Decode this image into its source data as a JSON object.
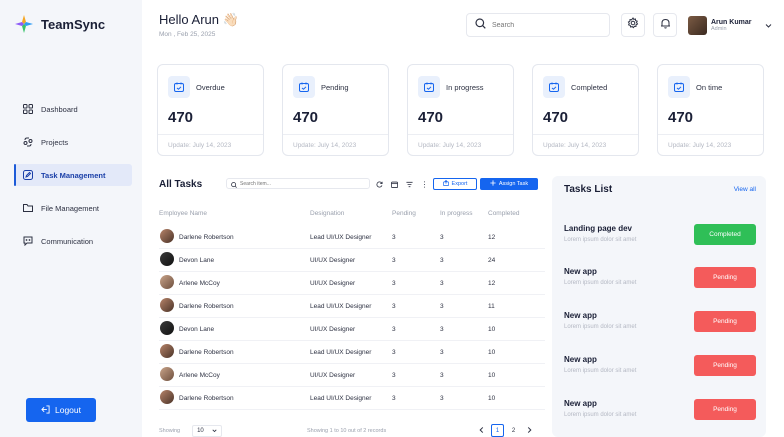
{
  "app": {
    "name": "TeamSync"
  },
  "sidebar": {
    "items": [
      {
        "label": "Dashboard",
        "icon": "grid-icon"
      },
      {
        "label": "Projects",
        "icon": "projects-icon"
      },
      {
        "label": "Task Management",
        "icon": "task-edit-icon",
        "active": true
      },
      {
        "label": "File Management",
        "icon": "folder-icon"
      },
      {
        "label": "Communication",
        "icon": "chat-icon"
      }
    ],
    "logout_label": "Logout"
  },
  "header": {
    "greeting": "Hello Arun 👋🏻",
    "date": "Mon , Feb 25, 2025",
    "search_placeholder": "Search",
    "user_name": "Arun Kumar",
    "user_role": "Admin"
  },
  "stats": [
    {
      "label": "Overdue",
      "value": "470",
      "update": "Update: July 14, 2023"
    },
    {
      "label": "Pending",
      "value": "470",
      "update": "Update: July 14, 2023"
    },
    {
      "label": "In progress",
      "value": "470",
      "update": "Update: July 14, 2023"
    },
    {
      "label": "Completed",
      "value": "470",
      "update": "Update: July 14, 2023"
    },
    {
      "label": "On time",
      "value": "470",
      "update": "Update: July 14, 2023"
    }
  ],
  "all_tasks": {
    "title": "All Tasks",
    "search_placeholder": "Search item...",
    "export_label": "Export",
    "assign_label": "Assign Task",
    "columns": [
      "Employee Name",
      "Designation",
      "Pending",
      "In progress",
      "Completed"
    ],
    "rows": [
      {
        "name": "Darlene Robertson",
        "designation": "Lead UI/UX Designer",
        "pending": "3",
        "progress": "3",
        "completed": "12"
      },
      {
        "name": "Devon Lane",
        "designation": "UI/UX Designer",
        "pending": "3",
        "progress": "3",
        "completed": "24"
      },
      {
        "name": "Arlene McCoy",
        "designation": "UI/UX Designer",
        "pending": "3",
        "progress": "3",
        "completed": "12"
      },
      {
        "name": "Darlene Robertson",
        "designation": "Lead UI/UX Designer",
        "pending": "3",
        "progress": "3",
        "completed": "11"
      },
      {
        "name": "Devon Lane",
        "designation": "UI/UX Designer",
        "pending": "3",
        "progress": "3",
        "completed": "10"
      },
      {
        "name": "Darlene Robertson",
        "designation": "Lead UI/UX Designer",
        "pending": "3",
        "progress": "3",
        "completed": "10"
      },
      {
        "name": "Arlene McCoy",
        "designation": "UI/UX Designer",
        "pending": "3",
        "progress": "3",
        "completed": "10"
      },
      {
        "name": "Darlene Robertson",
        "designation": "Lead UI/UX Designer",
        "pending": "3",
        "progress": "3",
        "completed": "10"
      }
    ],
    "footer": {
      "showing_label": "Showing",
      "page_size": "10",
      "info": "Showing 1 to 10 out of 2 records",
      "pages": [
        "1",
        "2"
      ]
    }
  },
  "tasks_list": {
    "title": "Tasks List",
    "view_all": "View all",
    "items": [
      {
        "name": "Landing page dev",
        "desc": "Lorem ipsum dolor sit amet",
        "status": "Completed",
        "color": "#2fbf57"
      },
      {
        "name": "New app",
        "desc": "Lorem ipsum dolor sit amet",
        "status": "Pending",
        "color": "#f45b5b"
      },
      {
        "name": "New app",
        "desc": "Lorem ipsum dolor sit amet",
        "status": "Pending",
        "color": "#f45b5b"
      },
      {
        "name": "New app",
        "desc": "Lorem ipsum dolor sit amet",
        "status": "Pending",
        "color": "#f45b5b"
      },
      {
        "name": "New app",
        "desc": "Lorem ipsum dolor sit amet",
        "status": "Pending",
        "color": "#f45b5b"
      }
    ]
  },
  "colors": {
    "accent": "#1565ef",
    "completed": "#2fbf57",
    "pending": "#f45b5b"
  }
}
